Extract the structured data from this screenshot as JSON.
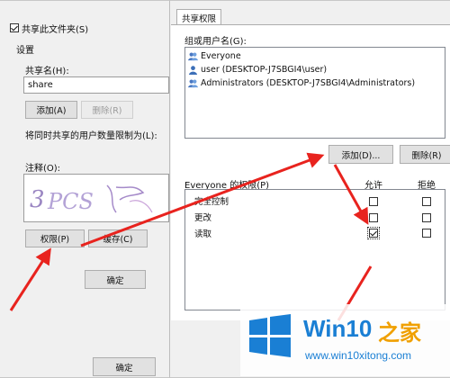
{
  "left_dialog": {
    "share_checkbox_label": "共享此文件夹(S)",
    "share_checked": true,
    "settings_label": "设置",
    "share_name_label": "共享名(H):",
    "share_name_value": "share",
    "add_button": "添加(A)",
    "remove_button": "删除(R)",
    "user_limit_label": "将同时共享的用户数量限制为(L):",
    "comment_label": "注释(O):",
    "permissions_button": "权限(P)",
    "cache_button": "缓存(C)",
    "ok_button": "确定"
  },
  "perm_dialog": {
    "tab": "共享权限",
    "group_label": "组或用户名(G):",
    "users": [
      {
        "name": "Everyone",
        "icon": "group-icon"
      },
      {
        "name": "user (DESKTOP-J7SBGI4\\user)",
        "icon": "user-icon"
      },
      {
        "name": "Administrators (DESKTOP-J7SBGI4\\Administrators)",
        "icon": "group-icon"
      }
    ],
    "add_button": "添加(D)...",
    "remove_button": "删除(R)",
    "perm_header": "Everyone 的权限(P)",
    "allow_header": "允许",
    "deny_header": "拒绝",
    "perms": [
      {
        "name": "完全控制",
        "allow": false,
        "deny": false
      },
      {
        "name": "更改",
        "allow": false,
        "deny": false
      },
      {
        "name": "读取",
        "allow": true,
        "deny": false
      }
    ],
    "ok_button": "确定"
  },
  "watermark": {
    "brand_prefix": "Win10",
    "brand_suffix": "之家",
    "url": "www.win10xitong.com"
  },
  "colors": {
    "arrow": "#e8231e",
    "win_blue": "#1a7fd4",
    "brand_orange": "#f0a000"
  }
}
